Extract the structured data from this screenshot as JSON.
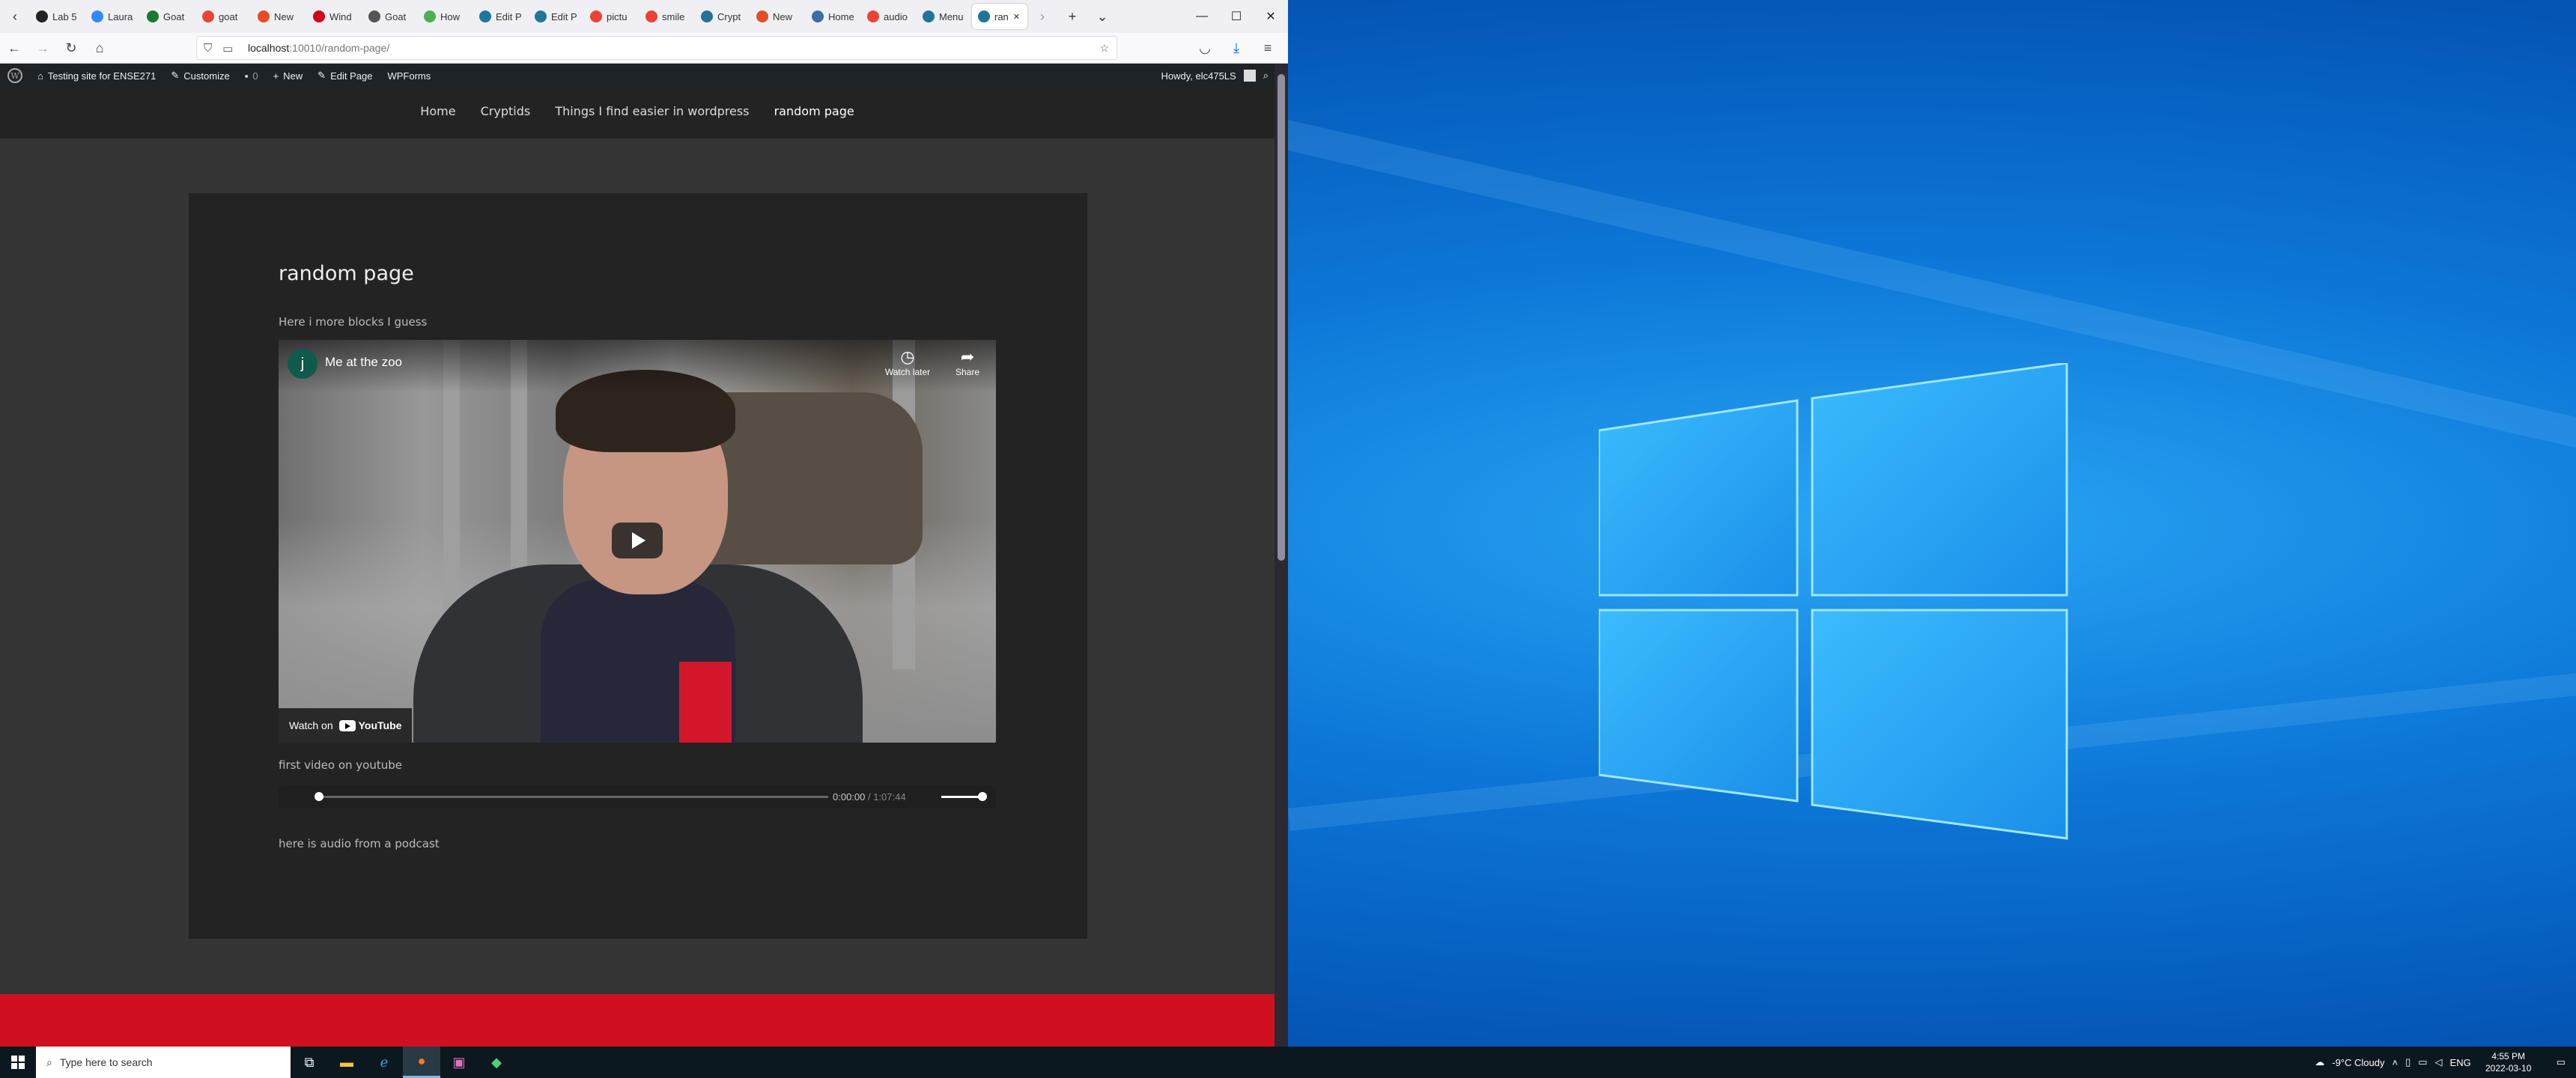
{
  "browser": {
    "tabs": [
      {
        "label": "Lab 5",
        "icon": "uregina-icon",
        "color": "#222222"
      },
      {
        "label": "Laura",
        "icon": "zoom-icon",
        "color": "#2d8cff"
      },
      {
        "label": "Goat",
        "icon": "green-circle-icon",
        "color": "#1a7a2a"
      },
      {
        "label": "goat",
        "icon": "google-icon",
        "color": "#ea4335"
      },
      {
        "label": "New",
        "icon": "tomato-icon",
        "color": "#e44d26"
      },
      {
        "label": "Wind",
        "icon": "opera-icon",
        "color": "#d0021b"
      },
      {
        "label": "Goat",
        "icon": "goat-icon",
        "color": "#555555"
      },
      {
        "label": "How",
        "icon": "leaf-icon",
        "color": "#4caf50"
      },
      {
        "label": "Edit P",
        "icon": "wordpress-icon",
        "color": "#21759b"
      },
      {
        "label": "Edit P",
        "icon": "wordpress-icon",
        "color": "#21759b"
      },
      {
        "label": "pictu",
        "icon": "google-icon",
        "color": "#ea4335"
      },
      {
        "label": "smile",
        "icon": "google-icon",
        "color": "#ea4335"
      },
      {
        "label": "Crypt",
        "icon": "wordpress-icon",
        "color": "#21759b"
      },
      {
        "label": "New",
        "icon": "tomato-icon",
        "color": "#e44d26"
      },
      {
        "label": "Home",
        "icon": "k-icon",
        "color": "#3a6ea5"
      },
      {
        "label": "audio",
        "icon": "google-icon",
        "color": "#ea4335"
      },
      {
        "label": "Menu",
        "icon": "wordpress-icon",
        "color": "#21759b"
      },
      {
        "label": "ran",
        "icon": "wordpress-icon",
        "color": "#21759b"
      }
    ],
    "url_host": "localhost",
    "url_path": ":10010/random-page/"
  },
  "adminbar": {
    "site": "Testing site for ENSE271",
    "customize": "Customize",
    "comments": "0",
    "new": "New",
    "edit": "Edit Page",
    "forms": "WPForms",
    "howdy": "Howdy, elc475LS"
  },
  "site_menu": [
    "Home",
    "Cryptids",
    "Things I find easier in wordpress",
    "random page"
  ],
  "page": {
    "title": "random page",
    "intro": "Here i more blocks I guess",
    "video": {
      "channel_initial": "j",
      "title": "Me at the zoo",
      "watch_later": "Watch later",
      "share": "Share",
      "watch_on": "Watch on",
      "youtube": "YouTube"
    },
    "video_caption": "first video on youtube",
    "audio": {
      "current": "0:00:00",
      "separator": " / ",
      "duration": "1:07:44",
      "progress": 0
    },
    "audio_caption": "here is audio from a podcast"
  },
  "taskbar": {
    "search_placeholder": "Type here to search",
    "weather": "-9°C  Cloudy",
    "lang": "ENG",
    "time": "4:55 PM",
    "date": "2022-03-10"
  }
}
